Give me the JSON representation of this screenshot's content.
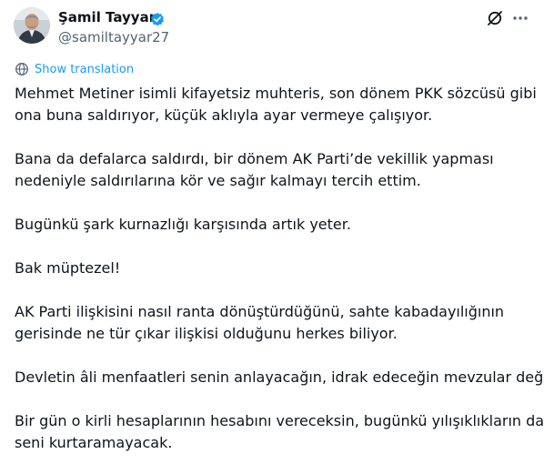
{
  "author": {
    "display_name": "Şamil Tayyar",
    "handle": "@samiltayyar27",
    "verified": true
  },
  "icons": {
    "verified": "verified-badge-icon",
    "grok": "grok-icon",
    "more": "more-horizontal-icon",
    "translate": "translate-globe-icon"
  },
  "colors": {
    "accent": "#1d9bf0",
    "text": "#0f1419",
    "secondary_text": "#536471"
  },
  "translate_label": "Show translation",
  "tweet": {
    "paragraphs": [
      {
        "lines": [
          "Mehmet Metiner isimli kifayetsiz muhteris, son dönem PKK sözcüsü gibi",
          "ona buna saldırıyor, küçük aklıyla ayar vermeye çalışıyor."
        ]
      },
      {
        "lines": [
          "Bana da defalarca saldırdı, bir dönem AK Parti’de vekillik yapması",
          "nedeniyle saldırılarına kör ve sağır kalmayı tercih ettim."
        ]
      },
      {
        "lines": [
          "Bugünkü şark kurnazlığı karşısında artık yeter."
        ]
      },
      {
        "lines": [
          "Bak müptezel!"
        ]
      },
      {
        "lines": [
          "AK Parti ilişkisini nasıl ranta dönüştürdüğünü, sahte kabadayılığının",
          "gerisinde ne tür çıkar ilişkisi olduğunu herkes biliyor."
        ]
      },
      {
        "lines": [
          "Devletin âli menfaatleri senin anlayacağın, idrak edeceğin mevzular değil."
        ]
      },
      {
        "lines": [
          "Bir gün o kirli hesaplarının hesabını vereceksin, bugünkü yılışıklıkların da",
          "seni kurtaramayacak."
        ]
      }
    ]
  }
}
